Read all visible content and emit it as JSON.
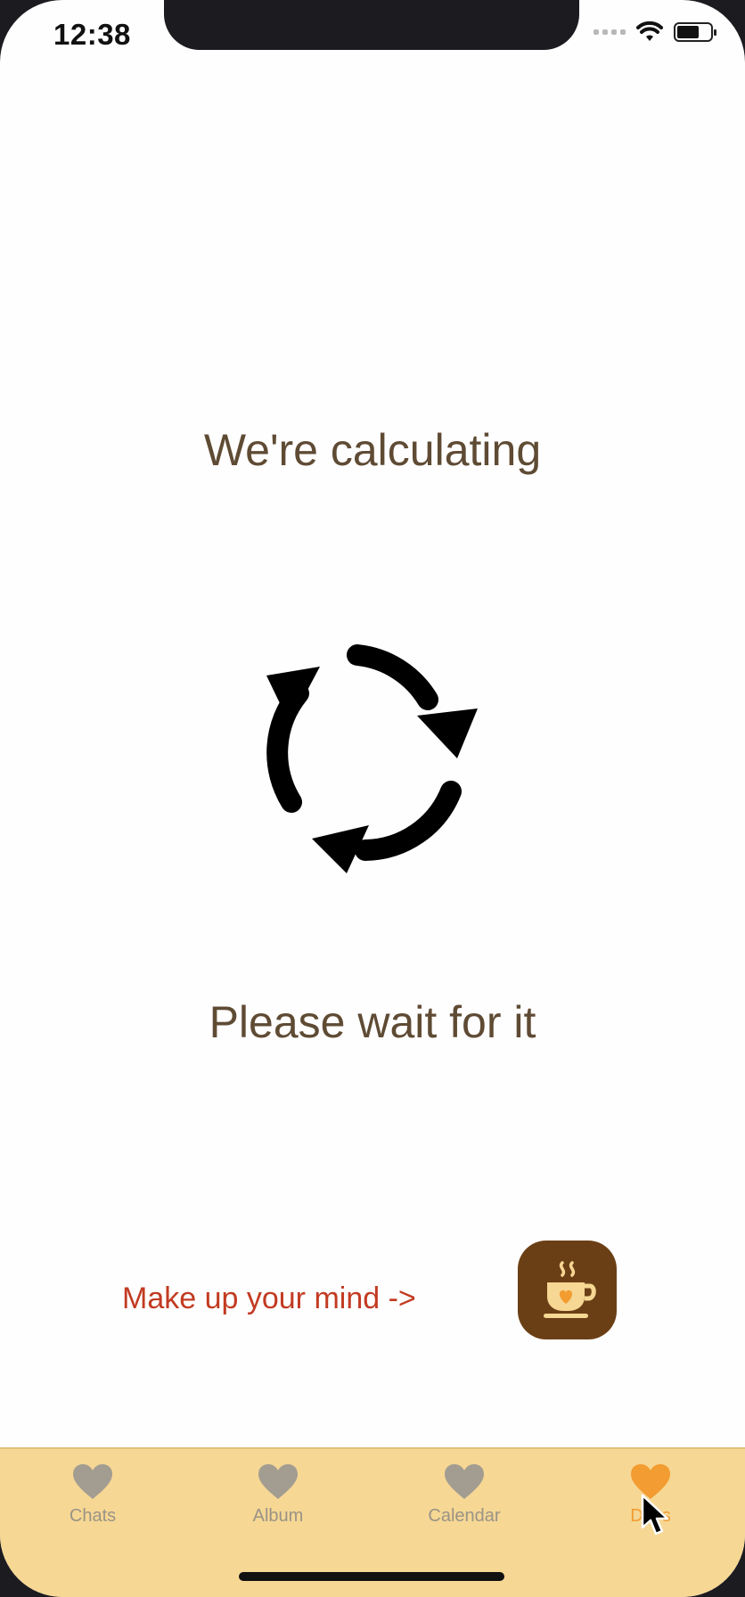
{
  "status_bar": {
    "time": "12:38"
  },
  "main": {
    "title": "We're calculating",
    "subtitle": "Please wait for it",
    "cta_text": "Make up your mind ->",
    "spinner_icon": "refresh-arrows-icon",
    "coffee_icon": "coffee-cup-heart-icon"
  },
  "tabs": [
    {
      "label": "Chats",
      "icon": "heart-icon",
      "active": false
    },
    {
      "label": "Album",
      "icon": "heart-icon",
      "active": false
    },
    {
      "label": "Calendar",
      "icon": "heart-icon",
      "active": false
    },
    {
      "label": "Days",
      "icon": "heart-icon",
      "active": true
    }
  ],
  "colors": {
    "text_brown": "#5f4b34",
    "cta_red": "#c23b22",
    "coffee_bg": "#6b3f15",
    "tabbar_bg": "#f6d794",
    "tab_inactive": "#9a9486",
    "tab_active": "#f29c31"
  }
}
